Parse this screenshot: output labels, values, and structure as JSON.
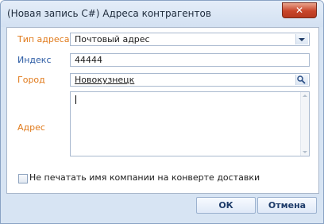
{
  "window": {
    "title": "(Новая запись C#) Адреса контрагентов",
    "close_symbol": "✕"
  },
  "form": {
    "address_type": {
      "label": "Тип адреса",
      "value": "Почтовый адрес"
    },
    "index": {
      "label": "Индекс",
      "value": "44444"
    },
    "city": {
      "label": "Город",
      "value": "Новокузнецк"
    },
    "address": {
      "label": "Адрес",
      "value": ""
    },
    "checkbox": {
      "label": "Не печатать имя компании на конверте доставки",
      "checked": false
    }
  },
  "buttons": {
    "ok": "ОК",
    "cancel": "Отмена"
  },
  "colors": {
    "required_label": "#e07a1b",
    "optional_label": "#2a5aa3",
    "window_bg": "#d7e4f3",
    "close_button": "#c8452a"
  },
  "icons": {
    "dropdown": "chevron-down-icon",
    "search": "search-icon",
    "close": "close-icon"
  }
}
